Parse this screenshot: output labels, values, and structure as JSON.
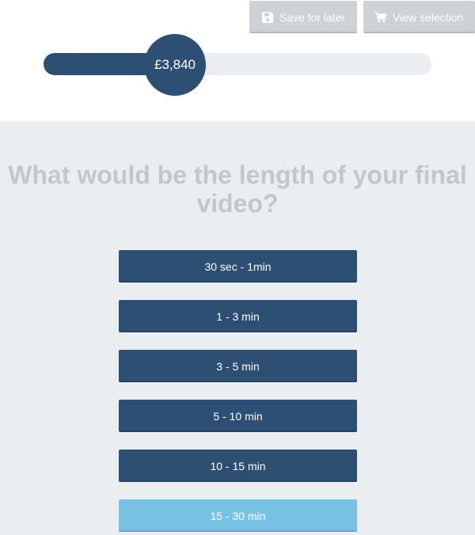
{
  "header": {
    "save_label": "Save for later",
    "view_label": "View selection",
    "save_icon": "floppy-disk-icon",
    "view_icon": "shopping-cart-icon"
  },
  "progress": {
    "amount": "£3,840",
    "fraction": 0.4
  },
  "question": {
    "title": "What would be the length of your final video?",
    "options": [
      "30 sec - 1min",
      "1 - 3 min",
      "3 - 5 min",
      "5 - 10 min",
      "10 - 15 min",
      "15 - 30 min"
    ],
    "highlighted_index": 5
  },
  "colors": {
    "primary": "#2d4f74",
    "highlight": "#78c3e5",
    "header_button": "#cfd2d4",
    "panel_bg": "#ebeef0",
    "title_text": "#c4c7c9"
  }
}
